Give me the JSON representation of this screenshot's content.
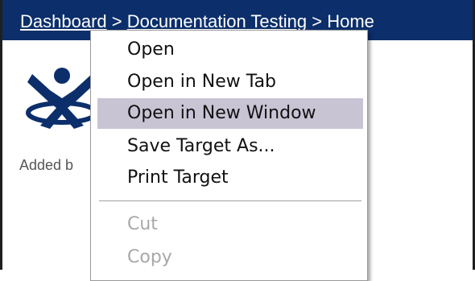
{
  "header": {
    "breadcrumb": {
      "items": [
        "Dashboard",
        "Documentation Testing",
        "Home"
      ],
      "separator": ">"
    }
  },
  "content": {
    "logo_icon": "x-figure-logo-icon",
    "added_by_text": "Added b"
  },
  "context_menu": {
    "items": [
      {
        "label": "Open",
        "state": "normal"
      },
      {
        "label": "Open in New Tab",
        "state": "normal"
      },
      {
        "label": "Open in New Window",
        "state": "highlighted"
      },
      {
        "label": "Save Target As...",
        "state": "normal"
      },
      {
        "label": "Print Target",
        "state": "normal"
      },
      {
        "label": "Cut",
        "state": "disabled"
      },
      {
        "label": "Copy",
        "state": "disabled"
      }
    ]
  },
  "colors": {
    "header_bg": "#0c2f6b",
    "highlight_bg": "#c8c4d4",
    "disabled_text": "#a8a8a8"
  }
}
